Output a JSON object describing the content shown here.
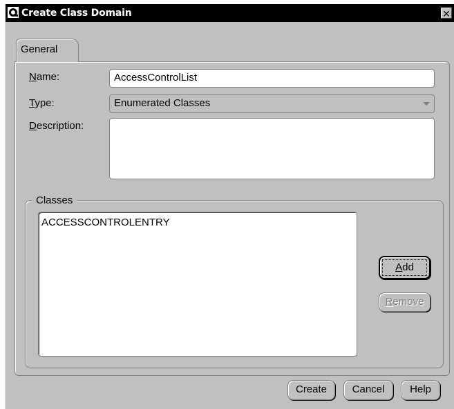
{
  "window": {
    "title": "Create Class Domain",
    "close_glyph": "✕"
  },
  "tabs": [
    {
      "label": "General",
      "selected": true
    }
  ],
  "form": {
    "name": {
      "label_mnemonic": "N",
      "label_rest": "ame:",
      "value": "AccessControlList"
    },
    "type": {
      "label_mnemonic": "T",
      "label_rest": "ype:",
      "value": "Enumerated Classes"
    },
    "description": {
      "label_mnemonic": "D",
      "label_rest": "escription:",
      "value": ""
    }
  },
  "classes": {
    "group_label": "Classes",
    "items": [
      "ACCESSCONTROLENTRY"
    ],
    "add_button": {
      "mnemonic": "A",
      "rest": "dd"
    },
    "remove_button": {
      "mnemonic": "R",
      "rest": "emove",
      "enabled": false
    }
  },
  "footer": {
    "create_label": "Create",
    "cancel_label": "Cancel",
    "help_label": "Help"
  },
  "colors": {
    "dialog_bg": "#c0c0c0",
    "titlebar_bg": "#000000",
    "field_bg": "#ffffff",
    "disabled_text": "#808080"
  }
}
